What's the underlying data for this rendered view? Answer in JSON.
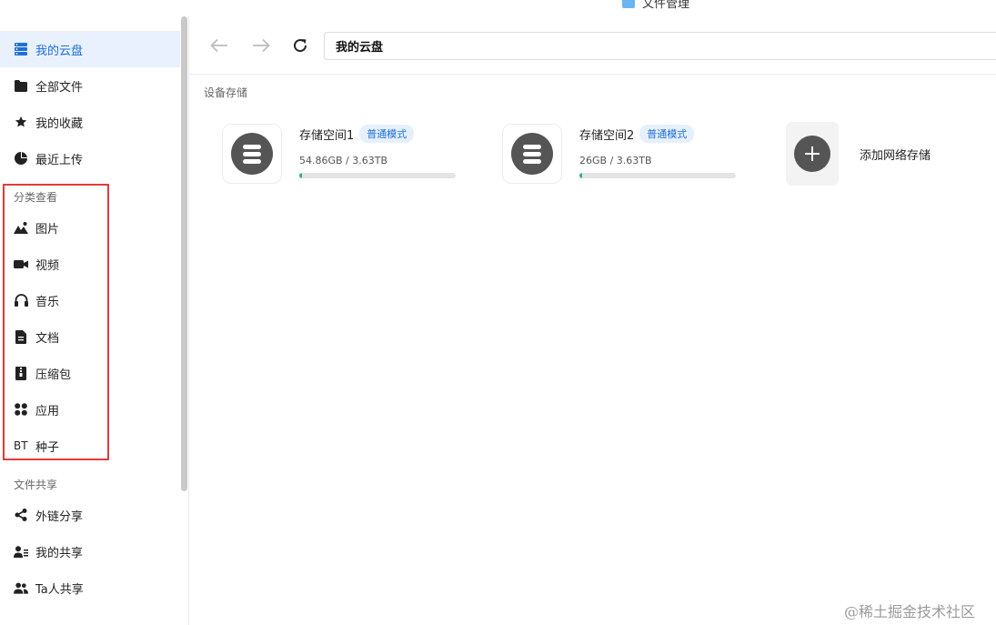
{
  "window": {
    "title": "文件管理"
  },
  "sidebar": {
    "items": [
      {
        "label": "我的云盘",
        "icon": "storage-icon",
        "active": true
      },
      {
        "label": "全部文件",
        "icon": "folder-icon"
      },
      {
        "label": "我的收藏",
        "icon": "star-icon"
      },
      {
        "label": "最近上传",
        "icon": "pie-clock-icon"
      }
    ],
    "category_title": "分类查看",
    "categories": [
      {
        "label": "图片",
        "icon": "image-icon"
      },
      {
        "label": "视频",
        "icon": "video-camera-icon"
      },
      {
        "label": "音乐",
        "icon": "headphones-icon"
      },
      {
        "label": "文档",
        "icon": "document-icon"
      },
      {
        "label": "压缩包",
        "icon": "archive-icon"
      },
      {
        "label": "应用",
        "icon": "apps-grid-icon"
      },
      {
        "label": "种子",
        "icon": "bt-icon",
        "icon_text": "BT"
      }
    ],
    "share_title": "文件共享",
    "shares": [
      {
        "label": "外链分享",
        "icon": "share-icon"
      },
      {
        "label": "我的共享",
        "icon": "user-share-icon"
      },
      {
        "label": "Ta人共享",
        "icon": "users-icon"
      }
    ]
  },
  "toolbar": {
    "path": "我的云盘"
  },
  "main": {
    "section_title": "设备存储",
    "storages": [
      {
        "name": "存储空间1",
        "badge": "普通模式",
        "usage": "54.86GB / 3.63TB",
        "used_fraction": 0.015
      },
      {
        "name": "存储空间2",
        "badge": "普通模式",
        "usage": "26GB / 3.63TB",
        "used_fraction": 0.007
      }
    ],
    "add_label": "添加网络存储"
  },
  "watermark": "@稀土掘金技术社区",
  "colors": {
    "accent": "#1f6fd6",
    "active_bg": "#e8f1fd",
    "progress": "#2bb673",
    "highlight_box": "#e23b3b"
  }
}
